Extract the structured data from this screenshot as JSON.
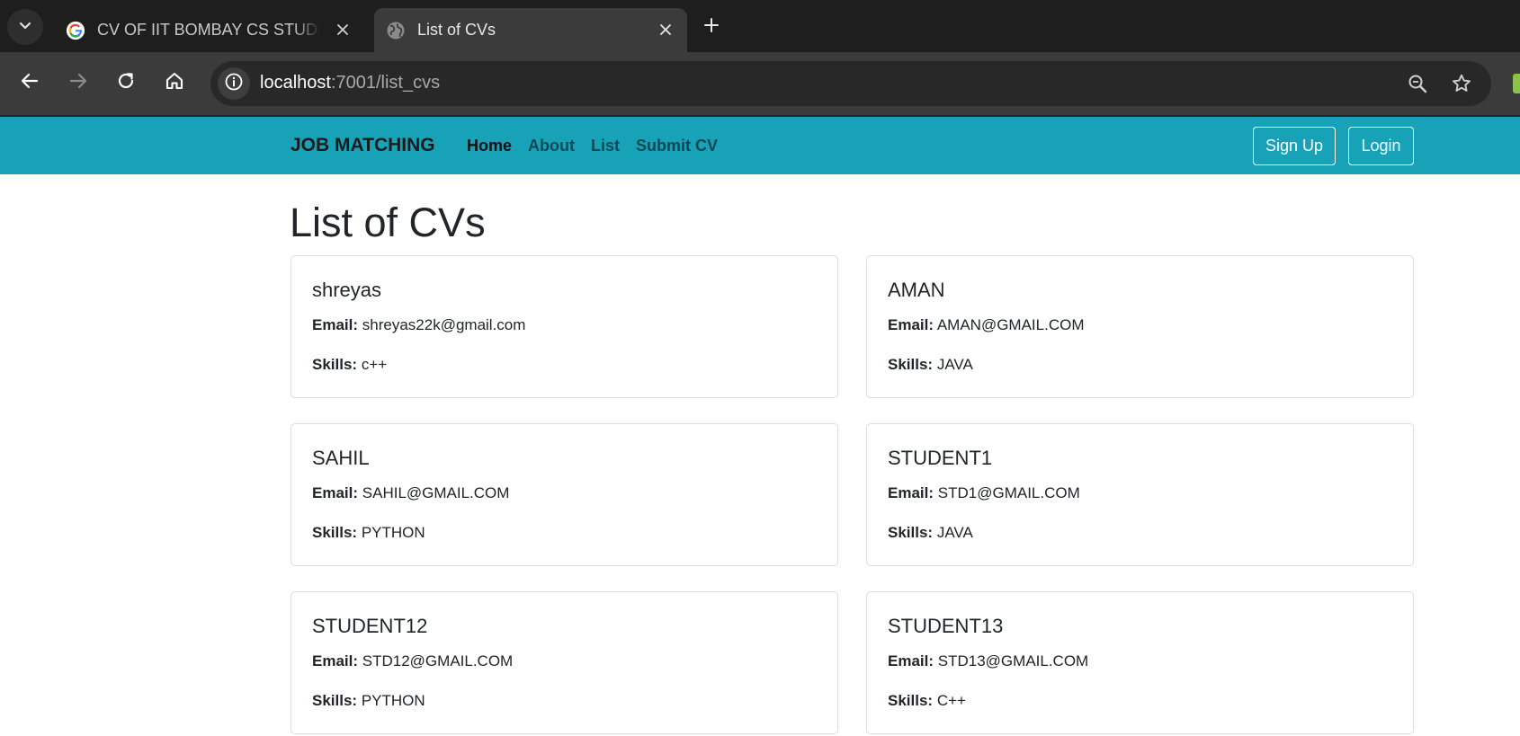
{
  "browser": {
    "tabs": [
      {
        "title": "CV OF IIT BOMBAY CS STUDENT",
        "favicon": "google-g-icon",
        "active": false
      },
      {
        "title": "List of CVs",
        "favicon": "globe-icon",
        "active": true
      }
    ],
    "url_host": "localhost",
    "url_rest": ":7001/list_cvs"
  },
  "navbar": {
    "brand": "JOB MATCHING",
    "links": [
      "Home",
      "About",
      "List",
      "Submit CV"
    ],
    "signup_label": "Sign Up",
    "login_label": "Login",
    "color": "#17a2b8"
  },
  "page": {
    "title": "List of CVs",
    "email_label": "Email:",
    "skills_label": "Skills:"
  },
  "cvs": [
    {
      "name": "shreyas",
      "email": "shreyas22k@gmail.com",
      "skills": "c++"
    },
    {
      "name": "AMAN",
      "email": "AMAN@GMAIL.COM",
      "skills": "JAVA"
    },
    {
      "name": "SAHIL",
      "email": "SAHIL@GMAIL.COM",
      "skills": "PYTHON"
    },
    {
      "name": "STUDENT1",
      "email": "STD1@GMAIL.COM",
      "skills": "JAVA"
    },
    {
      "name": "STUDENT12",
      "email": "STD12@GMAIL.COM",
      "skills": "PYTHON"
    },
    {
      "name": "STUDENT13",
      "email": "STD13@GMAIL.COM",
      "skills": "C++"
    }
  ]
}
